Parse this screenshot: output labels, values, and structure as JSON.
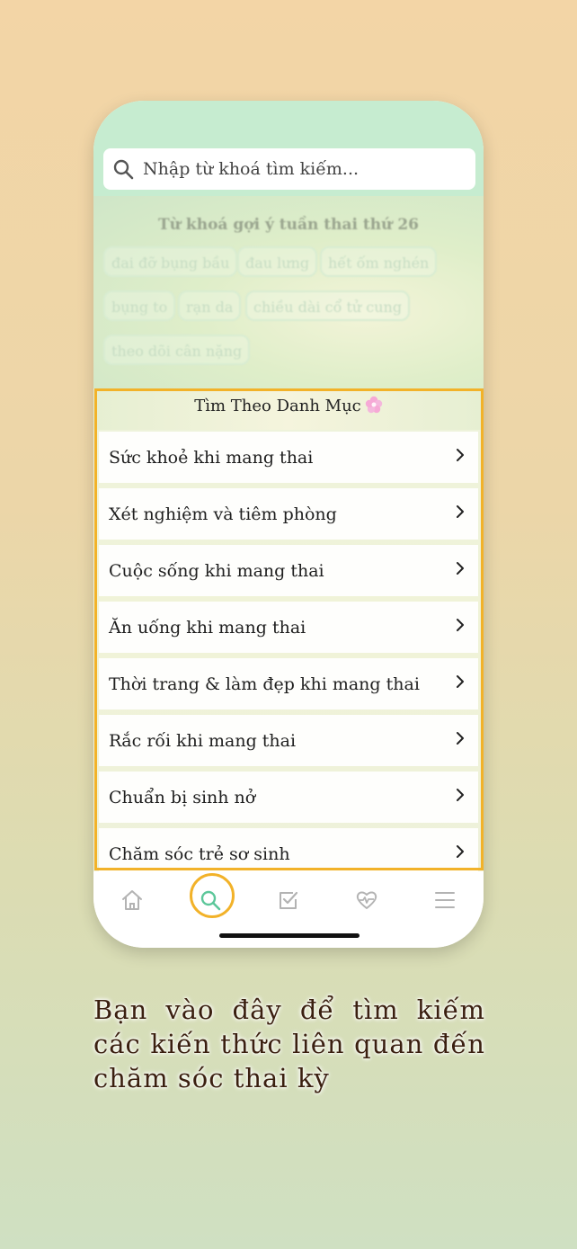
{
  "search": {
    "placeholder": "Nhập từ khoá tìm kiếm..."
  },
  "suggestions": {
    "title": "Từ khoá gợi ý tuần thai thứ 26",
    "chips": [
      "đai đỡ bụng bầu",
      "đau lưng",
      "hết ốm nghén",
      "bụng to",
      "rạn da",
      "chiều dài cổ tử cung",
      "theo dõi cân nặng"
    ]
  },
  "categories": {
    "title": "Tìm Theo Danh Mục",
    "items": [
      "Sức khoẻ khi mang thai",
      "Xét nghiệm và tiêm phòng",
      "Cuộc sống khi mang thai",
      "Ăn uống khi mang thai",
      "Thời trang & làm đẹp khi mang thai",
      "Rắc rối khi mang thai",
      "Chuẩn bị sinh nở",
      "Chăm sóc trẻ sơ sinh"
    ]
  },
  "tabbar": {
    "tabs": [
      {
        "icon": "home-icon",
        "active": false
      },
      {
        "icon": "search-icon",
        "active": true
      },
      {
        "icon": "checklist-icon",
        "active": false
      },
      {
        "icon": "heartbeat-icon",
        "active": false
      },
      {
        "icon": "menu-icon",
        "active": false
      }
    ],
    "active_color": "#5cc79a",
    "inactive_color": "#b3b3b3",
    "highlight_color": "#f2b229"
  },
  "caption": "Bạn vào đây để tìm kiếm các kiến thức liên quan đến chăm sóc thai kỳ"
}
